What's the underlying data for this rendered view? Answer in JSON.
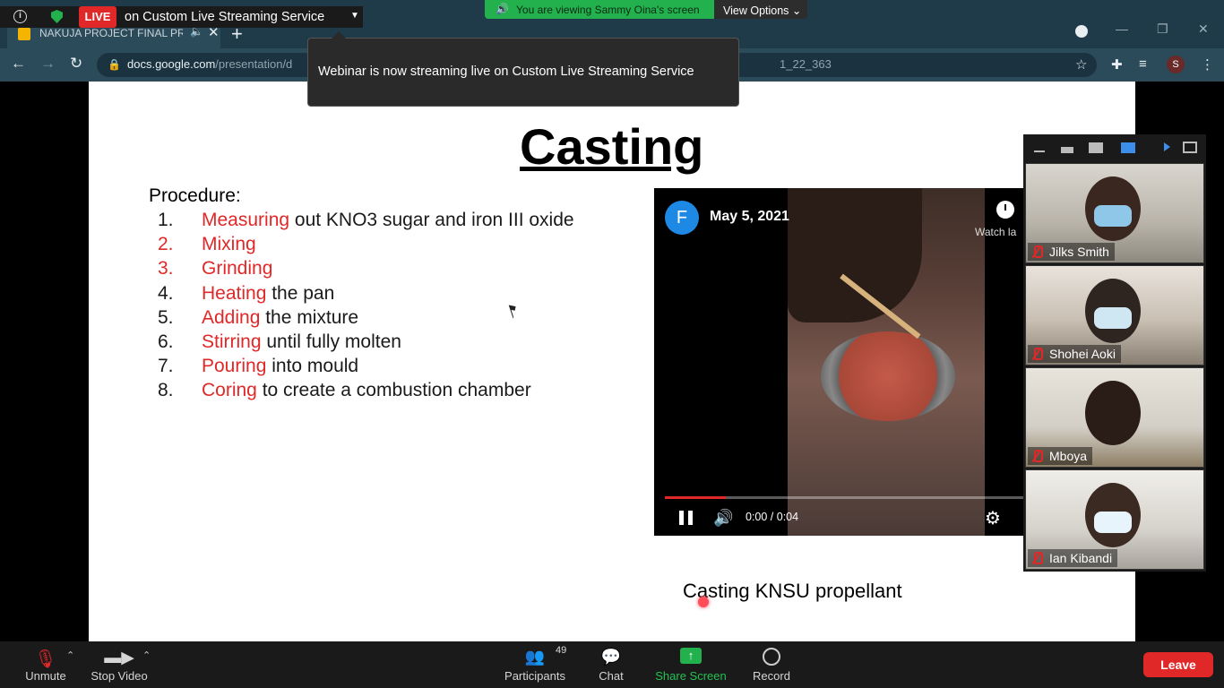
{
  "browser": {
    "tab_title": "NAKUJA PROJECT FINAL PRE",
    "url_host": "docs.google.com",
    "url_path": "/presentation/d",
    "url_tail": "1_22_363",
    "profile_initial": "S"
  },
  "zoom": {
    "live_badge": "LIVE",
    "live_text": "on Custom Live Streaming Service",
    "viewing_text": "You are viewing Sammy Oina's screen",
    "view_options": "View Options",
    "toast": "Webinar is now streaming live on Custom Live Streaming Service"
  },
  "slide": {
    "title": "Casting",
    "procedure_label": "Procedure:",
    "steps": [
      {
        "num": "1.",
        "key": "Measuring",
        "rest": " out KNO3 sugar and iron III oxide",
        "num_red": false
      },
      {
        "num": "2.",
        "key": "Mixing",
        "rest": "",
        "num_red": true
      },
      {
        "num": "3.",
        "key": "Grinding",
        "rest": "",
        "num_red": true
      },
      {
        "num": "4.",
        "key": "Heating",
        "rest": " the pan",
        "num_red": false
      },
      {
        "num": "5.",
        "key": "Adding",
        "rest": " the mixture",
        "num_red": false
      },
      {
        "num": "6.",
        "key": "Stirring",
        "rest": " until fully molten",
        "num_red": false
      },
      {
        "num": "7.",
        "key": "Pouring",
        "rest": " into mould",
        "num_red": false
      },
      {
        "num": "8.",
        "key": "Coring",
        "rest": " to create a combustion chamber",
        "num_red": false
      }
    ],
    "caption": "Casting KNSU propellant"
  },
  "video": {
    "channel_initial": "F",
    "date": "May 5, 2021",
    "watch_later": "Watch la",
    "time": "0:00 / 0:04",
    "progress_fraction": 0.17
  },
  "participants": [
    {
      "name": "Jilks Smith"
    },
    {
      "name": "Shohei Aoki"
    },
    {
      "name": "Mboya"
    },
    {
      "name": "Ian Kibandi"
    }
  ],
  "bottombar": {
    "unmute": "Unmute",
    "stop_video": "Stop Video",
    "participants": "Participants",
    "participants_count": "49",
    "chat": "Chat",
    "share_screen": "Share Screen",
    "record": "Record",
    "leave": "Leave"
  },
  "colors": {
    "accent_red": "#e02828",
    "zoom_green": "#23b14d",
    "browser_frame": "#2b4b5b"
  }
}
